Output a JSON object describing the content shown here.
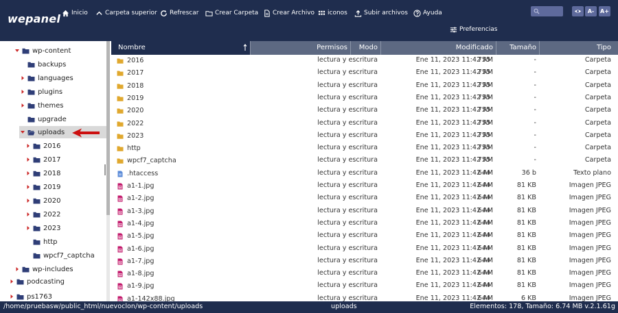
{
  "app": {
    "logo": "wepanel"
  },
  "toolbar": {
    "items": [
      {
        "label": "Inicio",
        "icon": "home-icon"
      },
      {
        "label": "Carpeta superior",
        "icon": "chevron-up-icon"
      },
      {
        "label": "Refrescar",
        "icon": "refresh-icon"
      },
      {
        "label": "Crear Carpeta",
        "icon": "folder-icon"
      },
      {
        "label": "Crear Archivo",
        "icon": "file-icon"
      },
      {
        "label": "iconos",
        "icon": "grid-icon"
      },
      {
        "label": "Subir archivos",
        "icon": "upload-icon"
      },
      {
        "label": "Ayuda",
        "icon": "help-icon"
      }
    ],
    "preferences": "Preferencias",
    "font_smaller": "A-",
    "font_larger": "A+"
  },
  "tree": {
    "items": [
      {
        "label": "wp-content",
        "level": 0,
        "expanded": true
      },
      {
        "label": "backups",
        "level": 1,
        "expanded": null
      },
      {
        "label": "languages",
        "level": 1,
        "expanded": false
      },
      {
        "label": "plugins",
        "level": 1,
        "expanded": false
      },
      {
        "label": "themes",
        "level": 1,
        "expanded": false
      },
      {
        "label": "upgrade",
        "level": 1,
        "expanded": null
      },
      {
        "label": "uploads",
        "level": 1,
        "expanded": true,
        "selected": true
      },
      {
        "label": "2016",
        "level": 2,
        "expanded": false
      },
      {
        "label": "2017",
        "level": 2,
        "expanded": false
      },
      {
        "label": "2018",
        "level": 2,
        "expanded": false
      },
      {
        "label": "2019",
        "level": 2,
        "expanded": false
      },
      {
        "label": "2020",
        "level": 2,
        "expanded": false
      },
      {
        "label": "2022",
        "level": 2,
        "expanded": false
      },
      {
        "label": "2023",
        "level": 2,
        "expanded": false
      },
      {
        "label": "http",
        "level": 2,
        "expanded": null
      },
      {
        "label": "wpcf7_captcha",
        "level": 2,
        "expanded": null
      },
      {
        "label": "wp-includes",
        "level": 0,
        "expanded": false
      },
      {
        "label": "podcasting",
        "level": -1,
        "expanded": false
      },
      {
        "label": "ps1763",
        "level": -1,
        "expanded": false
      }
    ]
  },
  "table": {
    "columns": {
      "name": "Nombre",
      "perm": "Permisos",
      "mode": "Modo",
      "modified": "Modificado",
      "size": "Tamaño",
      "type": "Tipo"
    },
    "rows": [
      {
        "name": "2016",
        "kind": "folder",
        "perm": "lectura y escritura",
        "mode": "755",
        "modified": "Ene 11, 2023 11:42 AM",
        "size": "-",
        "type": "Carpeta"
      },
      {
        "name": "2017",
        "kind": "folder",
        "perm": "lectura y escritura",
        "mode": "755",
        "modified": "Ene 11, 2023 11:42 AM",
        "size": "-",
        "type": "Carpeta"
      },
      {
        "name": "2018",
        "kind": "folder",
        "perm": "lectura y escritura",
        "mode": "755",
        "modified": "Ene 11, 2023 11:42 AM",
        "size": "-",
        "type": "Carpeta"
      },
      {
        "name": "2019",
        "kind": "folder",
        "perm": "lectura y escritura",
        "mode": "755",
        "modified": "Ene 11, 2023 11:42 AM",
        "size": "-",
        "type": "Carpeta"
      },
      {
        "name": "2020",
        "kind": "folder",
        "perm": "lectura y escritura",
        "mode": "755",
        "modified": "Ene 11, 2023 11:42 AM",
        "size": "-",
        "type": "Carpeta"
      },
      {
        "name": "2022",
        "kind": "folder",
        "perm": "lectura y escritura",
        "mode": "755",
        "modified": "Ene 11, 2023 11:42 AM",
        "size": "-",
        "type": "Carpeta"
      },
      {
        "name": "2023",
        "kind": "folder",
        "perm": "lectura y escritura",
        "mode": "755",
        "modified": "Ene 11, 2023 11:42 AM",
        "size": "-",
        "type": "Carpeta"
      },
      {
        "name": "http",
        "kind": "folder",
        "perm": "lectura y escritura",
        "mode": "755",
        "modified": "Ene 11, 2023 11:42 AM",
        "size": "-",
        "type": "Carpeta"
      },
      {
        "name": "wpcf7_captcha",
        "kind": "folder",
        "perm": "lectura y escritura",
        "mode": "755",
        "modified": "Ene 11, 2023 11:42 AM",
        "size": "-",
        "type": "Carpeta"
      },
      {
        "name": ".htaccess",
        "kind": "text",
        "perm": "lectura y escritura",
        "mode": "644",
        "modified": "Ene 11, 2023 11:42 AM",
        "size": "36 b",
        "type": "Texto plano"
      },
      {
        "name": "a1-1.jpg",
        "kind": "image",
        "perm": "lectura y escritura",
        "mode": "644",
        "modified": "Ene 11, 2023 11:42 AM",
        "size": "81 KB",
        "type": "Imagen JPEG"
      },
      {
        "name": "a1-2.jpg",
        "kind": "image",
        "perm": "lectura y escritura",
        "mode": "644",
        "modified": "Ene 11, 2023 11:42 AM",
        "size": "81 KB",
        "type": "Imagen JPEG"
      },
      {
        "name": "a1-3.jpg",
        "kind": "image",
        "perm": "lectura y escritura",
        "mode": "644",
        "modified": "Ene 11, 2023 11:42 AM",
        "size": "81 KB",
        "type": "Imagen JPEG"
      },
      {
        "name": "a1-4.jpg",
        "kind": "image",
        "perm": "lectura y escritura",
        "mode": "644",
        "modified": "Ene 11, 2023 11:42 AM",
        "size": "81 KB",
        "type": "Imagen JPEG"
      },
      {
        "name": "a1-5.jpg",
        "kind": "image",
        "perm": "lectura y escritura",
        "mode": "644",
        "modified": "Ene 11, 2023 11:42 AM",
        "size": "81 KB",
        "type": "Imagen JPEG"
      },
      {
        "name": "a1-6.jpg",
        "kind": "image",
        "perm": "lectura y escritura",
        "mode": "644",
        "modified": "Ene 11, 2023 11:42 AM",
        "size": "81 KB",
        "type": "Imagen JPEG"
      },
      {
        "name": "a1-7.jpg",
        "kind": "image",
        "perm": "lectura y escritura",
        "mode": "644",
        "modified": "Ene 11, 2023 11:42 AM",
        "size": "81 KB",
        "type": "Imagen JPEG"
      },
      {
        "name": "a1-8.jpg",
        "kind": "image",
        "perm": "lectura y escritura",
        "mode": "644",
        "modified": "Ene 11, 2023 11:42 AM",
        "size": "81 KB",
        "type": "Imagen JPEG"
      },
      {
        "name": "a1-9.jpg",
        "kind": "image",
        "perm": "lectura y escritura",
        "mode": "644",
        "modified": "Ene 11, 2023 11:42 AM",
        "size": "81 KB",
        "type": "Imagen JPEG"
      },
      {
        "name": "a1-142x88.jpg",
        "kind": "image",
        "perm": "lectura y escritura",
        "mode": "644",
        "modified": "Ene 11, 2023 11:42 AM",
        "size": "6 KB",
        "type": "Imagen JPEG"
      }
    ]
  },
  "status": {
    "path": "/home/pruebasw/public_html/nuevoclon/wp-content/uploads",
    "folder": "uploads",
    "info": "Elementos: 178, Tamaño: 6.74 MB v.2.1.61g"
  },
  "colors": {
    "navy": "#1f2d4e",
    "header": "#5d6982",
    "folder": "#e0a82e",
    "tree_folder": "#2f3e77",
    "image_file": "#c2186b",
    "text_file": "#5b8bd8",
    "arrow_red": "#cc1010"
  }
}
